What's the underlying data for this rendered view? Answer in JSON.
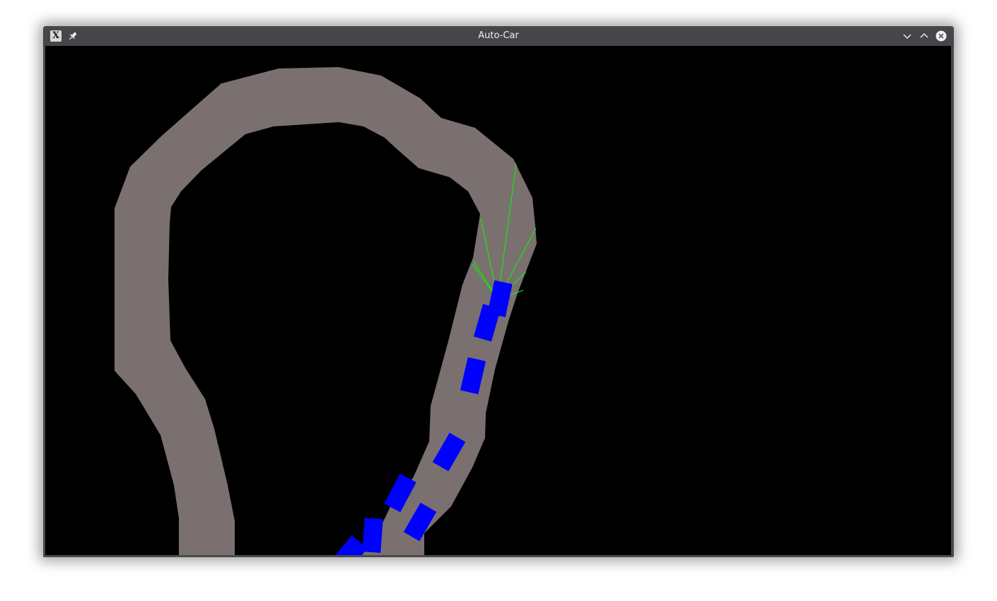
{
  "window": {
    "title": "Auto-Car",
    "icons": {
      "app": "x11-app-icon",
      "pin": "pin-icon",
      "minimize": "chevron-down-icon",
      "maximize": "chevron-up-icon",
      "close": "close-icon"
    }
  },
  "scene": {
    "background_color": "#000000",
    "track_color": "#7a706f",
    "car_color": "#0000ff",
    "sensor_color": "#00ff00",
    "cars_visible": 9,
    "sensor_rays": 7
  }
}
